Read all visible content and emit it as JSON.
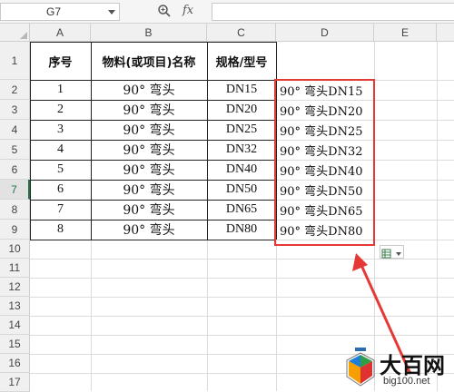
{
  "formula_bar": {
    "name_box": "G7",
    "fx_label": "fx",
    "formula": ""
  },
  "columns": [
    "A",
    "B",
    "C",
    "D",
    "E"
  ],
  "rows": [
    "1",
    "2",
    "3",
    "4",
    "5",
    "6",
    "7",
    "8",
    "9",
    "10",
    "11",
    "12",
    "13",
    "14",
    "15",
    "16",
    "17"
  ],
  "selected_row": "7",
  "header": {
    "a": "序号",
    "b": "物料(或项目)名称",
    "c": "规格/型号",
    "d": ""
  },
  "data_rows": [
    {
      "a": "1",
      "b": "90° 弯头",
      "c": "DN15",
      "d": "90° 弯头DN15"
    },
    {
      "a": "2",
      "b": "90° 弯头",
      "c": "DN20",
      "d": "90° 弯头DN20"
    },
    {
      "a": "3",
      "b": "90° 弯头",
      "c": "DN25",
      "d": "90° 弯头DN25"
    },
    {
      "a": "4",
      "b": "90° 弯头",
      "c": "DN32",
      "d": "90° 弯头DN32"
    },
    {
      "a": "5",
      "b": "90° 弯头",
      "c": "DN40",
      "d": "90° 弯头DN40"
    },
    {
      "a": "6",
      "b": "90° 弯头",
      "c": "DN50",
      "d": "90° 弯头DN50"
    },
    {
      "a": "7",
      "b": "90° 弯头",
      "c": "DN65",
      "d": "90° 弯头DN65"
    },
    {
      "a": "8",
      "b": "90° 弯头",
      "c": "DN80",
      "d": "90° 弯头DN80"
    }
  ],
  "watermark": {
    "title": "大百网",
    "url": "big100.net"
  },
  "colors": {
    "annotation_red": "#e53935",
    "selection_green": "#217346"
  }
}
